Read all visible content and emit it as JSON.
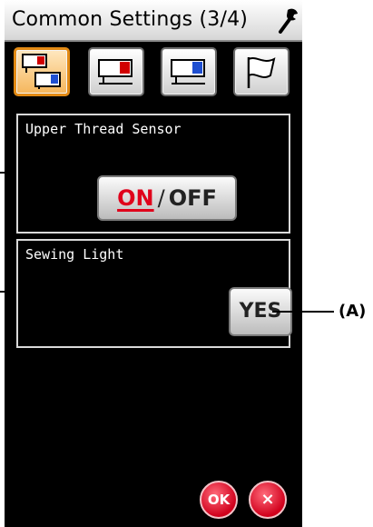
{
  "title": "Common Settings (3/4)",
  "icons": {
    "wrench": "wrench-icon",
    "tab1": "common-settings-icon",
    "tab2": "red-machine-icon",
    "tab3": "blue-machine-icon",
    "tab4": "flag-icon"
  },
  "tabs": [
    {
      "label": "common",
      "active": true
    },
    {
      "label": "red",
      "active": false
    },
    {
      "label": "blue",
      "active": false
    },
    {
      "label": "flag",
      "active": false
    }
  ],
  "upper_thread_sensor": {
    "label": "Upper Thread Sensor",
    "on_label": "ON",
    "separator": "/",
    "off_label": "OFF",
    "state": "ON"
  },
  "sewing_light": {
    "label": "Sewing Light",
    "value": "YES"
  },
  "footer": {
    "ok_label": "OK",
    "cancel_label": "×"
  },
  "callout": "(A)",
  "colors": {
    "screen_bg": "#000000",
    "active_tab": "#f5b65c",
    "on_red": "#e0001b",
    "round_button": "#d1001c"
  }
}
